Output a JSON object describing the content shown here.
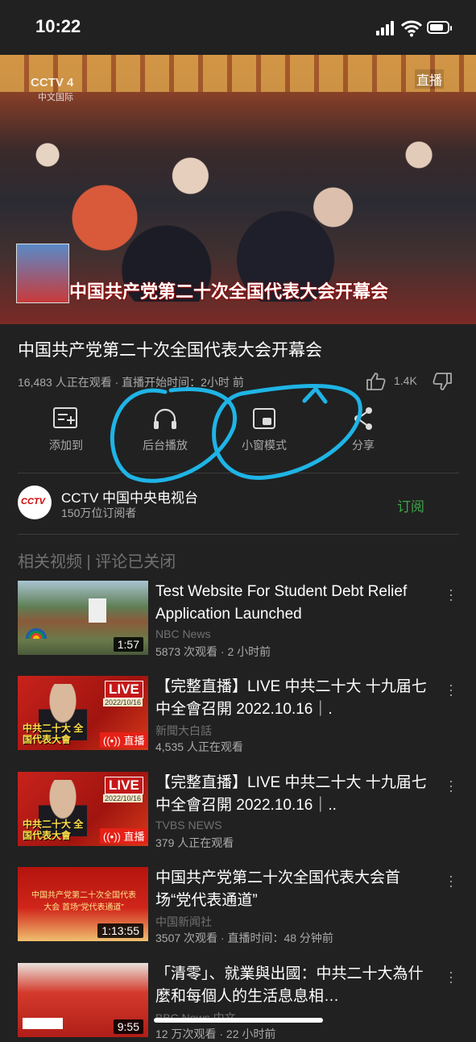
{
  "status_bar": {
    "time": "10:22"
  },
  "video": {
    "channel_logo": "CCTV 4",
    "channel_logo_sub": "中文国际",
    "live_badge": "直播",
    "banner_text": "中国共产党第二十次全国代表大会开幕会"
  },
  "info": {
    "title": "中国共产党第二十次全国代表大会开幕会",
    "meta": "16,483 人正在观看 · 直播开始时间：2小时 前",
    "likes": "1.4K"
  },
  "actions": [
    {
      "label": "添加到",
      "icon": "add-to-playlist-icon"
    },
    {
      "label": "后台播放",
      "icon": "headphones-icon"
    },
    {
      "label": "小窗模式",
      "icon": "picture-in-picture-icon"
    },
    {
      "label": "分享",
      "icon": "share-icon"
    }
  ],
  "channel": {
    "avatar_text": "CCTV",
    "name": "CCTV 中国中央电视台",
    "subscribers": "150万位订阅者",
    "subscribe_label": "订阅"
  },
  "related_header": "相关视频 | 评论已关闭",
  "related": [
    {
      "title": "Test Website For Student Debt Relief Application Launched",
      "channel": "NBC News",
      "stats": "5873 次观看 · 2 小时前",
      "duration": "1:57"
    },
    {
      "title": "【完整直播】LIVE 中共二十大 十九届七中全會召開 2022.10.16｜.",
      "channel": "新聞大白話",
      "stats": "4,535 人正在观看",
      "live_label": "LIVE",
      "live_chip": "直播",
      "date_label": "2022/10/16",
      "thumb_text": "中共二十大 全国代表大會"
    },
    {
      "title": "【完整直播】LIVE 中共二十大  十九届七中全會召開 2022.10.16｜..",
      "channel": "TVBS NEWS",
      "stats": "379 人正在观看",
      "live_label": "LIVE",
      "live_chip": "直播",
      "date_label": "2022/10/16",
      "thumb_text": "中共二十大 全国代表大會"
    },
    {
      "title": "中国共产党第二十次全国代表大会首场“党代表通道”",
      "channel": "中国新闻社",
      "stats": "3507 次观看 · 直播时间：48 分钟前",
      "duration": "1:13:55",
      "thumb_text": "中国共产党第二十次全国代表大会 首场“党代表通道”"
    },
    {
      "title": "「清零」、就業與出國：中共二十大為什麼和每個人的生活息息相…",
      "channel": "BBC News 中文",
      "stats": "12 万次观看 · 22 小时前",
      "duration": "9:55"
    }
  ],
  "colors": {
    "background": "#212121",
    "subscribe": "#3ea54a",
    "annotation": "#1fb4e6"
  }
}
